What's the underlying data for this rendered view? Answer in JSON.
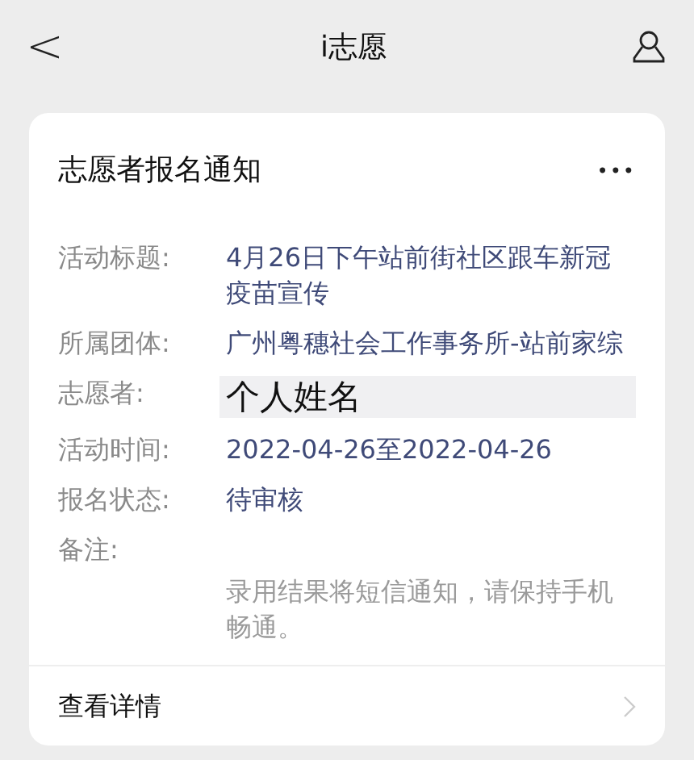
{
  "nav": {
    "back": "<",
    "title": "i志愿"
  },
  "card": {
    "title": "志愿者报名通知",
    "more": "•••",
    "fields": [
      {
        "label": "活动标题:",
        "value": "4月26日下午站前街社区跟车新冠疫苗宣传",
        "kind": "value"
      },
      {
        "label": "所属团体:",
        "value": "广州粤穗社会工作事务所-站前家综",
        "kind": "value"
      },
      {
        "label": "志愿者:",
        "value": "个人姓名",
        "kind": "name"
      },
      {
        "label": "活动时间:",
        "value": "2022-04-26至2022-04-26",
        "kind": "value"
      },
      {
        "label": "报名状态:",
        "value": "待审核",
        "kind": "value"
      },
      {
        "label": "备注:",
        "value": "录用结果将短信通知，请保持手机畅通。",
        "kind": "note"
      }
    ],
    "footer": "查看详情"
  }
}
